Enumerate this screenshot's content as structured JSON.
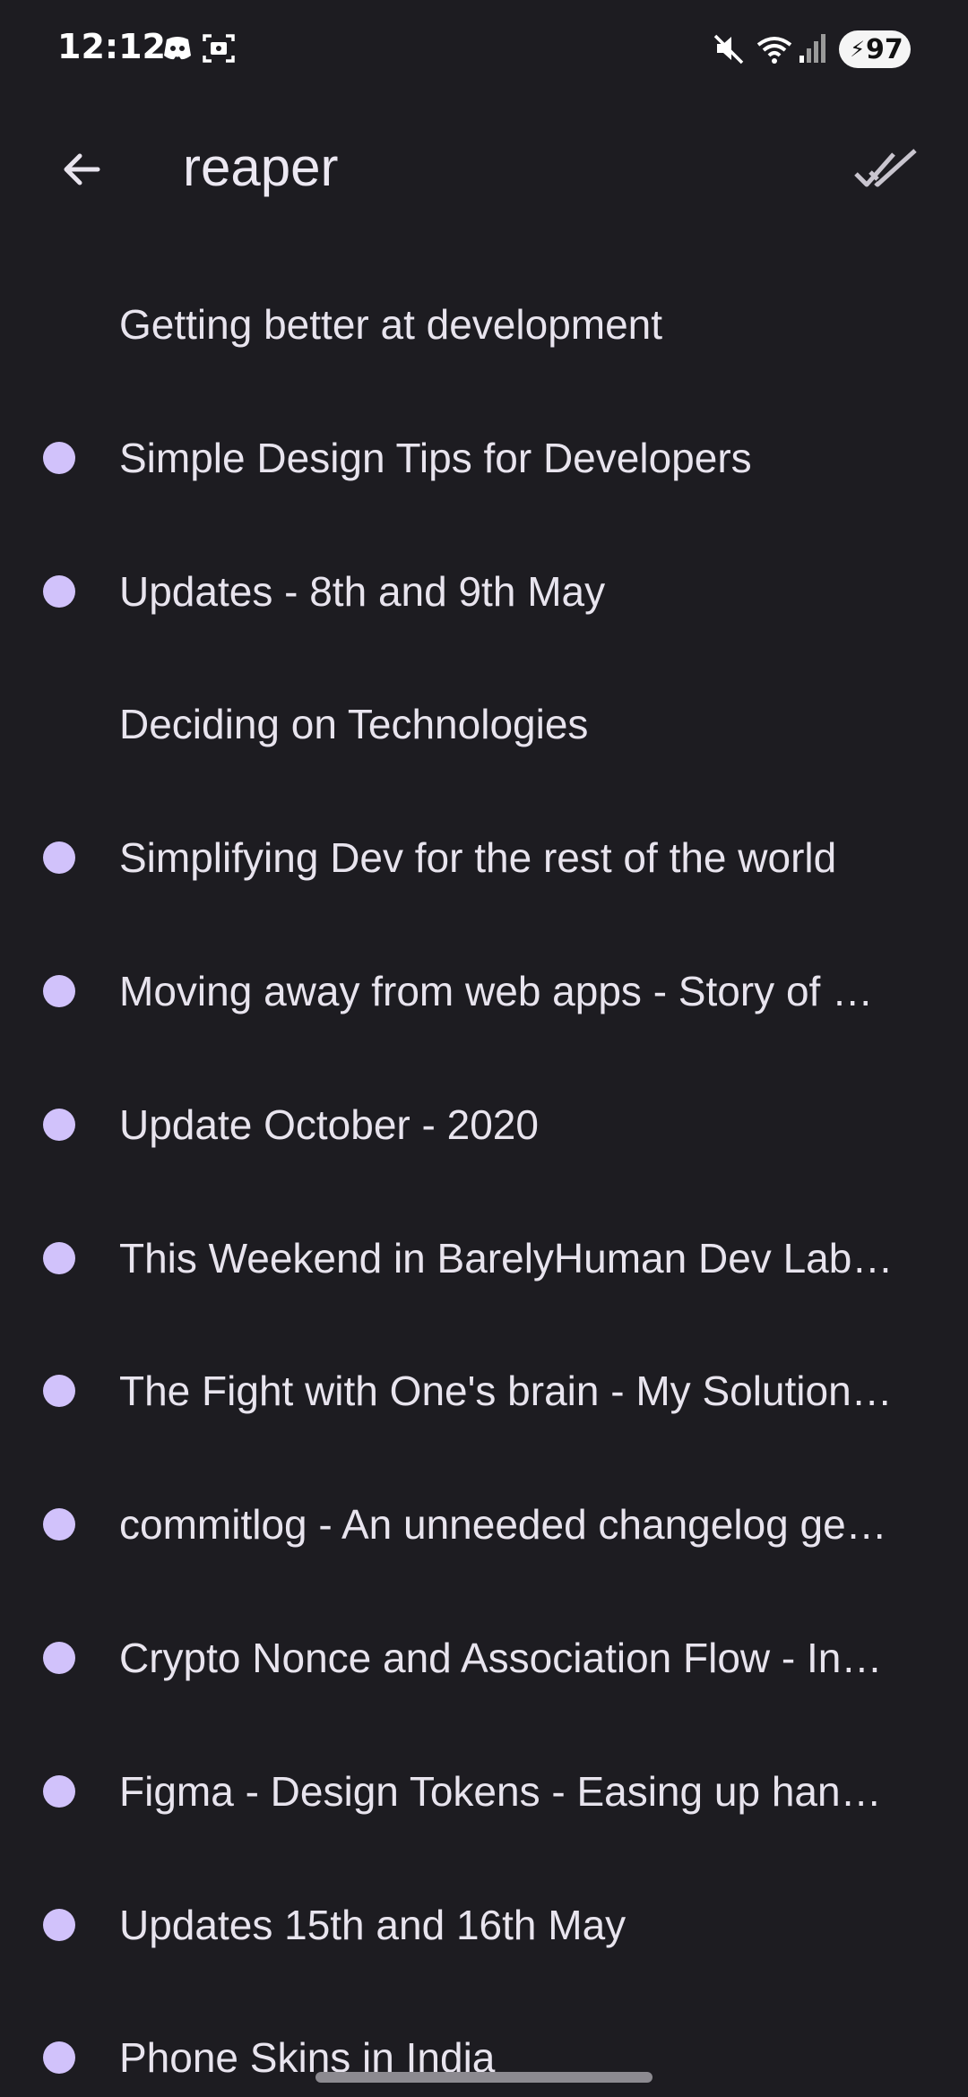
{
  "status_bar": {
    "time": "12:12",
    "battery": "97",
    "icons": [
      "discord-icon",
      "screenshot-icon",
      "mute-icon",
      "wifi-icon",
      "signal-icon",
      "charging-icon"
    ]
  },
  "app_bar": {
    "title": "reaper",
    "back_icon": "arrow-left-icon",
    "action_icon": "double-check-icon"
  },
  "colors": {
    "background": "#1d1c21",
    "unread_dot": "#d1c2fb",
    "text": "#e8e4ee"
  },
  "items": [
    {
      "title": "Getting better at development",
      "unread": false
    },
    {
      "title": "Simple Design Tips for Developers",
      "unread": true
    },
    {
      "title": "Updates - 8th and 9th May",
      "unread": true
    },
    {
      "title": "Deciding on Technologies",
      "unread": false
    },
    {
      "title": "Simplifying Dev for the rest of the world",
      "unread": true
    },
    {
      "title": "Moving away from web apps - Story of …",
      "unread": true
    },
    {
      "title": "Update October - 2020",
      "unread": true
    },
    {
      "title": "This Weekend in BarelyHuman Dev Lab…",
      "unread": true
    },
    {
      "title": "The Fight with One's brain - My Solution…",
      "unread": true
    },
    {
      "title": "commitlog - An unneeded changelog ge…",
      "unread": true
    },
    {
      "title": "Crypto Nonce and Association Flow - In…",
      "unread": true
    },
    {
      "title": "Figma - Design Tokens - Easing up han…",
      "unread": true
    },
    {
      "title": "Updates 15th and 16th May",
      "unread": true
    },
    {
      "title": "Phone Skins in India",
      "unread": true
    }
  ]
}
